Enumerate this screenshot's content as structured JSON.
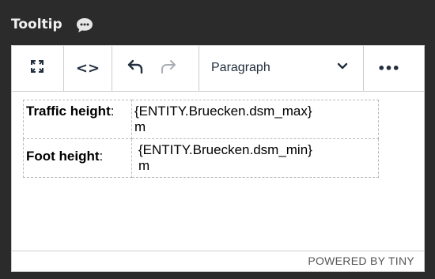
{
  "header": {
    "title": "Tooltip",
    "icon": "chat-bubble-icon"
  },
  "toolbar": {
    "fullscreen_icon": "fullscreen-icon",
    "code_icon": "code-icon",
    "code_label": "<>",
    "undo_icon": "undo-icon",
    "redo_icon": "redo-icon",
    "block_format": "Paragraph",
    "dropdown_icon": "chevron-down-icon",
    "more_icon": "more-icon",
    "more_label": "•••"
  },
  "table": {
    "rows": [
      {
        "label": "Traffic height",
        "label_suffix": ":",
        "value": "{ENTITY.Bruecken.dsm_max}",
        "unit": "m"
      },
      {
        "label": "Foot height",
        "label_suffix": ":",
        "value": "{ENTITY.Bruecken.dsm_min}",
        "unit": "m"
      }
    ]
  },
  "statusbar": {
    "branding": "POWERED BY TINY"
  },
  "colors": {
    "header_bg": "#2b2b2b",
    "toolbar_text": "#222f3e",
    "border": "#cccccc"
  }
}
